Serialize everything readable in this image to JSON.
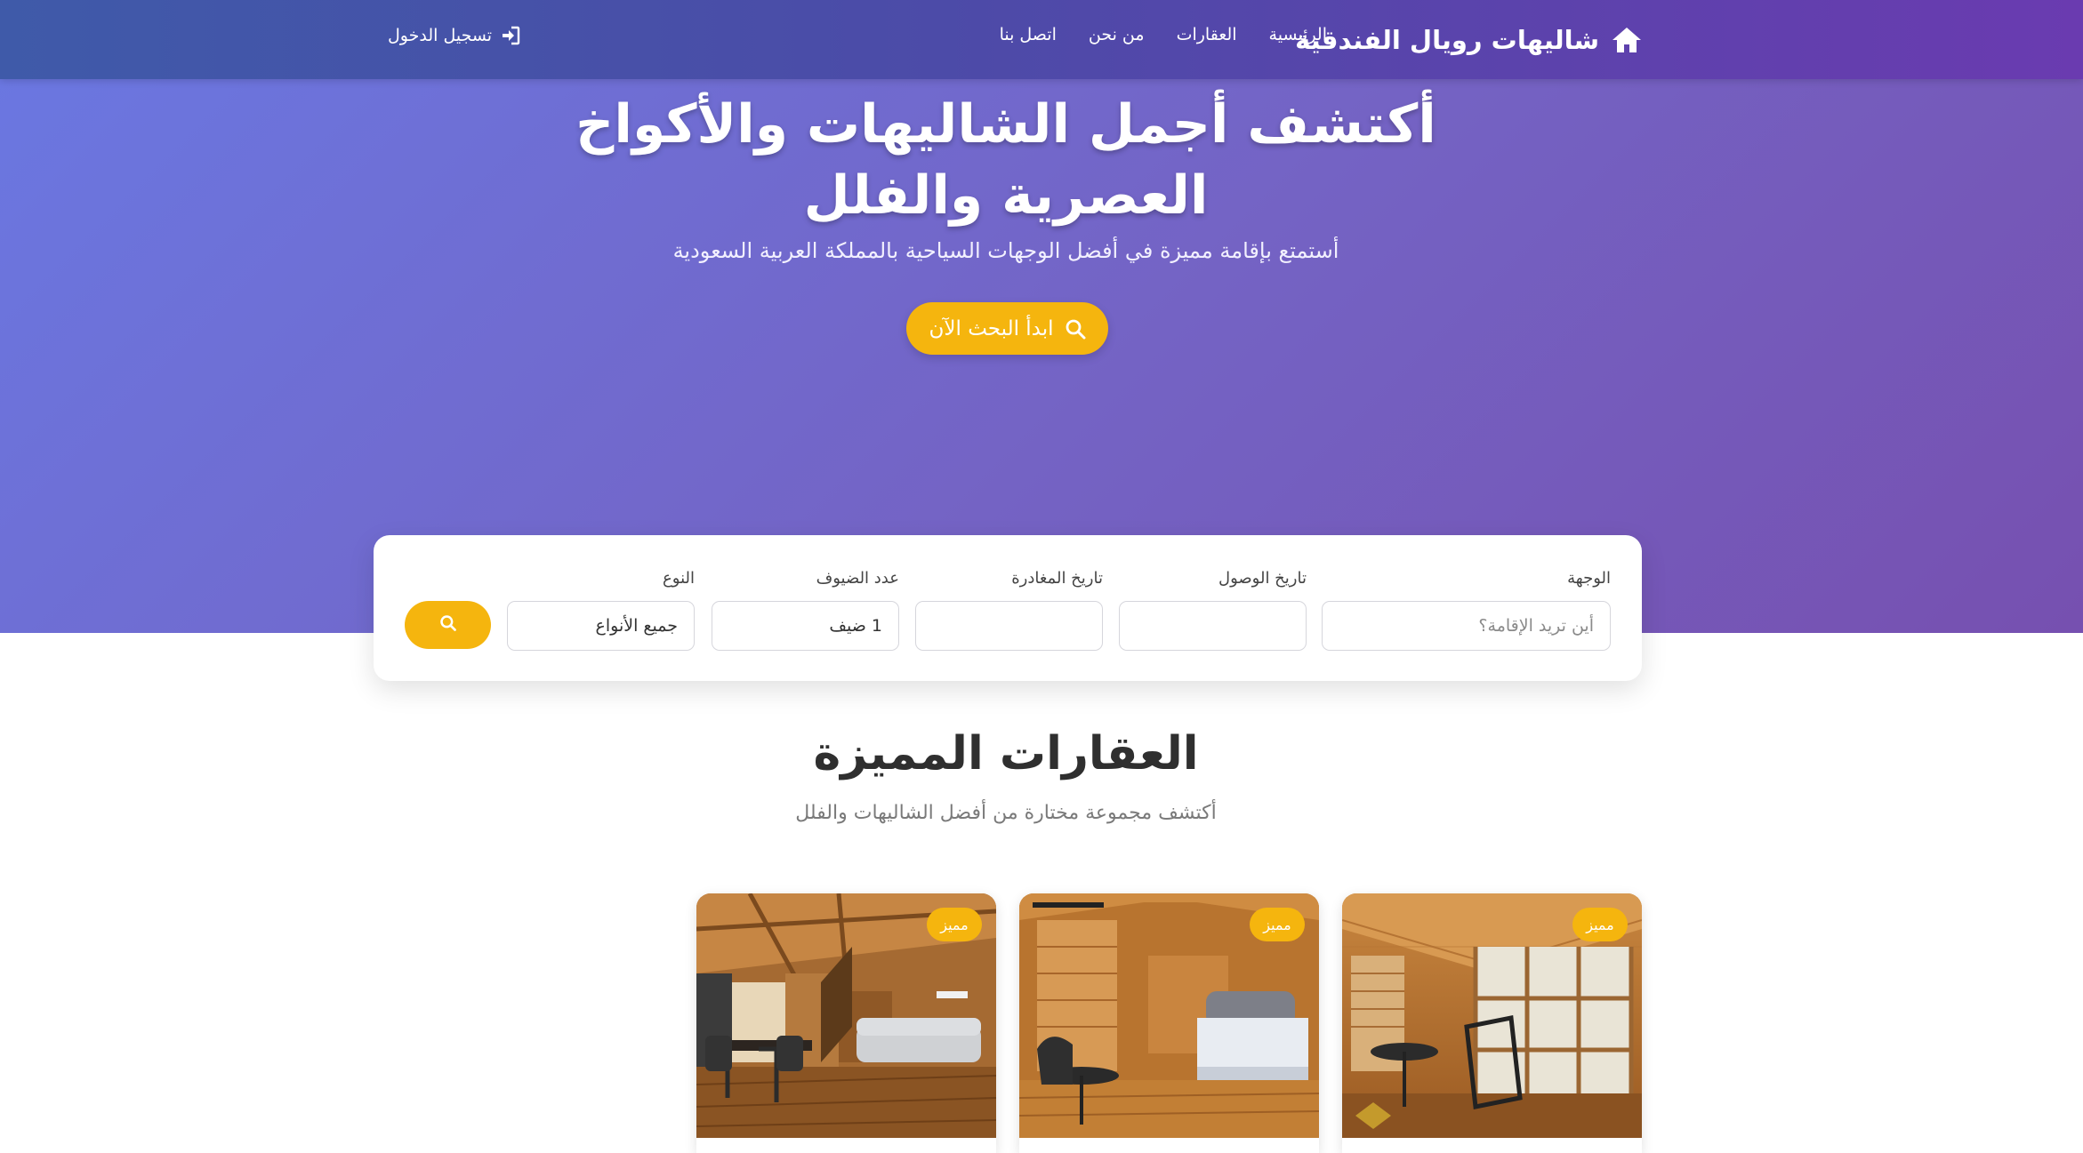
{
  "nav": {
    "brand": "شاليهات رويال الفندقية",
    "brand_icon": "home-icon",
    "links": [
      "الرئيسية",
      "العقارات",
      "من نحن",
      "اتصل بنا"
    ],
    "login": "تسجيل الدخول",
    "login_icon": "sign-in-icon"
  },
  "hero": {
    "title_line1": "أكتشف أجمل الشاليهات والأكواخ",
    "title_line2": "العصرية والفلل",
    "subtitle": "أستمتع بإقامة مميزة في أفضل الوجهات السياحية بالمملكة العربية السعودية",
    "cta": "ابدأ البحث الآن",
    "cta_icon": "search-icon"
  },
  "search": {
    "destination_label": "الوجهة",
    "destination_placeholder": "أين تريد الإقامة؟",
    "checkin_label": "تاريخ الوصول",
    "checkin_value": "",
    "checkout_label": "تاريخ المغادرة",
    "checkout_value": "",
    "guests_label": "عدد الضيوف",
    "guests_value": "1 ضيف",
    "type_label": "النوع",
    "type_value": "جميع الأنواع",
    "button_icon": "search-icon"
  },
  "featured": {
    "title": "العقارات المميزة",
    "subtitle": "أكتشف مجموعة مختارة من أفضل الشاليهات والفلل",
    "cards": [
      {
        "badge": "مميز",
        "image": "wooden-chalet-balcony-photo"
      },
      {
        "badge": "مميز",
        "image": "wooden-chalet-bedroom-photo"
      },
      {
        "badge": "مميز",
        "image": "wooden-chalet-living-room-photo"
      }
    ]
  },
  "colors": {
    "accent": "#f5b50e",
    "nav_start": "#3f5aa9",
    "nav_end": "#6a3bb0",
    "hero_start": "#6a78e2",
    "hero_end": "#7650b0"
  }
}
